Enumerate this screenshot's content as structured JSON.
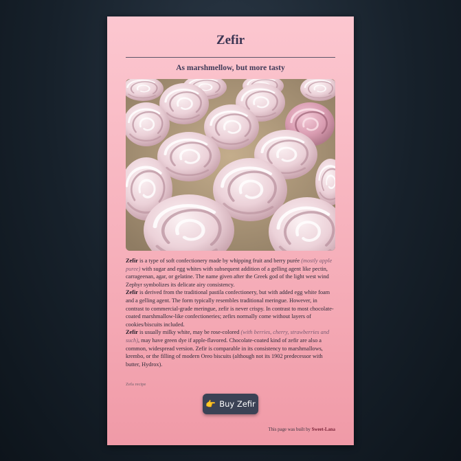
{
  "page": {
    "title": "Zefir",
    "subtitle": "As marshmellow, but more tasty",
    "image_caption": "Zefa recipe",
    "paragraphs": [
      {
        "bold": "Zefir",
        "text1": " is a type of soft confectionery made by whipping fruit and berry purée ",
        "italic": "(mostly apple puree)",
        "text2": " with sugar and egg whites with subsequent addition of a gelling agent like pectin, carrageenan, agar, or gelatine. The name given after the Greek god of the light west wind Zephyr symbolizes its delicate airy consistency."
      },
      {
        "bold": "Zefir",
        "text1": " is derived from the traditional pastila confectionery, but with added egg white foam and a gelling agent. The form typically resembles traditional meringue. However, in contrast to commercial-grade meringue, zefir is never crispy. In contrast to most chocolate-coated marshmallow-like confectioneries; zefirs normally come without layers of cookies/biscuits included.",
        "italic": "",
        "text2": ""
      },
      {
        "bold": "Zefir",
        "text1": " is usually milky white, may be rose-colored ",
        "italic": "(with berries, cherry, strawberries and such)",
        "text2": ", may have green dye if apple-flavored. Chocolate-coated kind of zefir are also a common, widespread version. Zefir is comparable in its consistency to marshmallows, krembo, or the filling of modern Oreo biscuits (although not its 1902 predecessor with butter, Hydrox)."
      }
    ],
    "buy_button": {
      "icon": "👉",
      "label": "Buy Zefir"
    },
    "footer": {
      "prefix": "This page was built by",
      "author": "Sweet-Lana"
    }
  },
  "colors": {
    "card_top": "#fcc7d0",
    "card_bottom": "#f09aa7",
    "button": "#3b4255",
    "author": "#7a2338"
  }
}
